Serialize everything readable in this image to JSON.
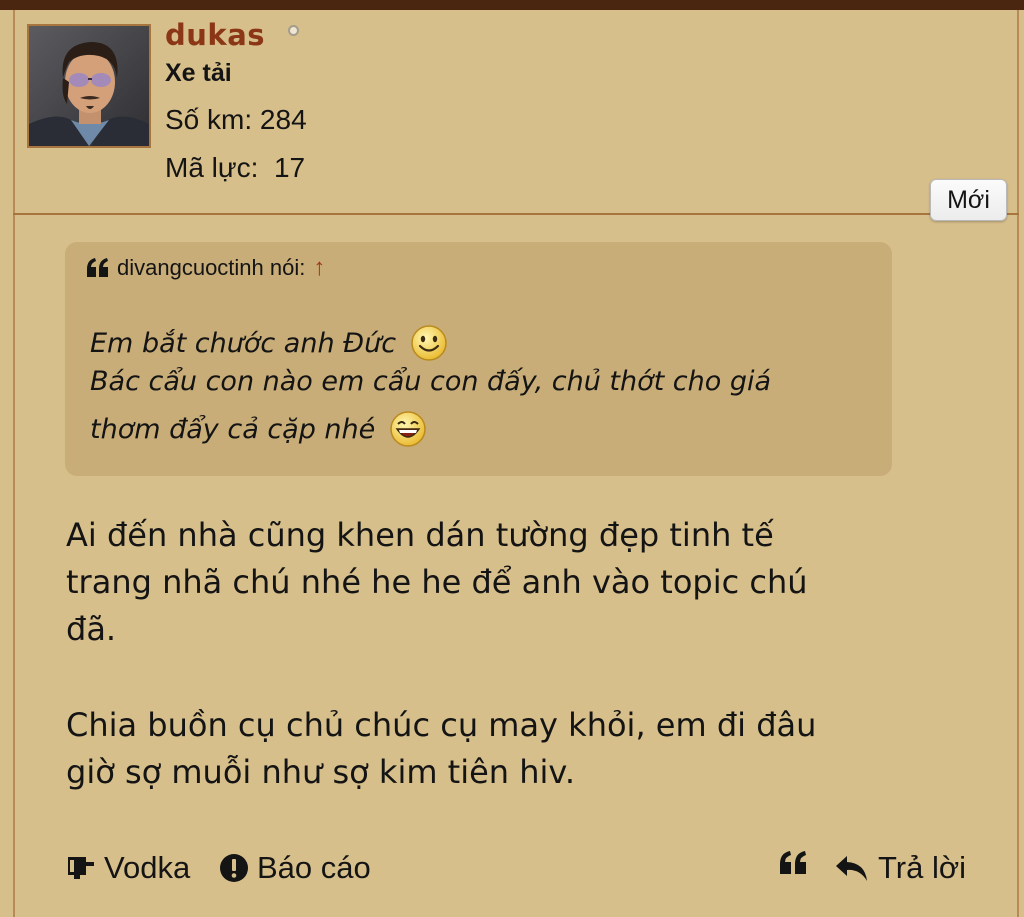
{
  "user": {
    "name": "dukas",
    "rank": "Xe tải",
    "km_label": "Số km:",
    "km_value": "284",
    "hp_label": "Mã lực:",
    "hp_value": "17",
    "status": "offline"
  },
  "badge": {
    "label": "Mới"
  },
  "quote": {
    "author_line": "divangcuoctinh nói:",
    "jump_arrow": "↑",
    "lines": [
      "Em bắt chước anh Đức",
      "Bác cẩu con nào em cẩu con đấy, chủ thớt cho giá",
      "thơm đẩy cả cặp nhé"
    ],
    "icon": "quote-icon",
    "smileys": [
      "smile-emoji",
      "laughing-emoji"
    ]
  },
  "body": {
    "lines": [
      "Ai đến nhà cũng khen dán tường đẹp tinh tế",
      "trang nhã chú nhé he he để anh vào topic chú",
      "đã.",
      "Chia buồn cụ chủ chúc cụ may khỏi, em đi đâu",
      "giờ sợ muỗi như sợ kim tiên hiv."
    ]
  },
  "actions": {
    "vodka": "Vodka",
    "report": "Báo cáo",
    "reply": "Trả lời"
  },
  "colors": {
    "background": "#d7bf8b",
    "quote_bg": "#c9ad78",
    "username": "#8b3716",
    "top_bar": "#4a2610"
  }
}
